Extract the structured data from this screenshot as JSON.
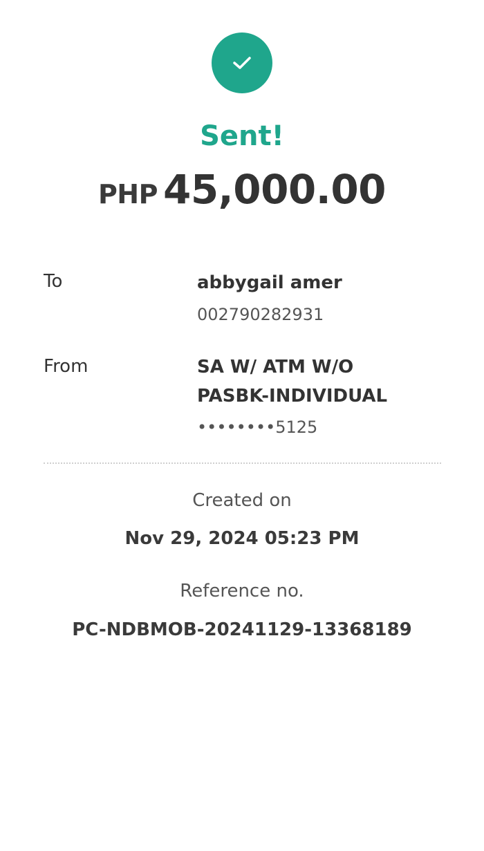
{
  "status": {
    "icon": "checkmark-icon",
    "title": "Sent!",
    "accent_color": "#1fa68c"
  },
  "amount": {
    "currency": "PHP",
    "value": "45,000.00"
  },
  "recipient": {
    "label": "To",
    "name": "abbygail amer",
    "account_number": "002790282931"
  },
  "source": {
    "label": "From",
    "account_type_line1": "SA W/ ATM W/O",
    "account_type_line2": "PASBK-INDIVIDUAL",
    "account_masked": "••••••••5125"
  },
  "created": {
    "label": "Created on",
    "value": "Nov 29, 2024 05:23 PM"
  },
  "reference": {
    "label": "Reference no.",
    "value": "PC-NDBMOB-20241129-13368189"
  }
}
